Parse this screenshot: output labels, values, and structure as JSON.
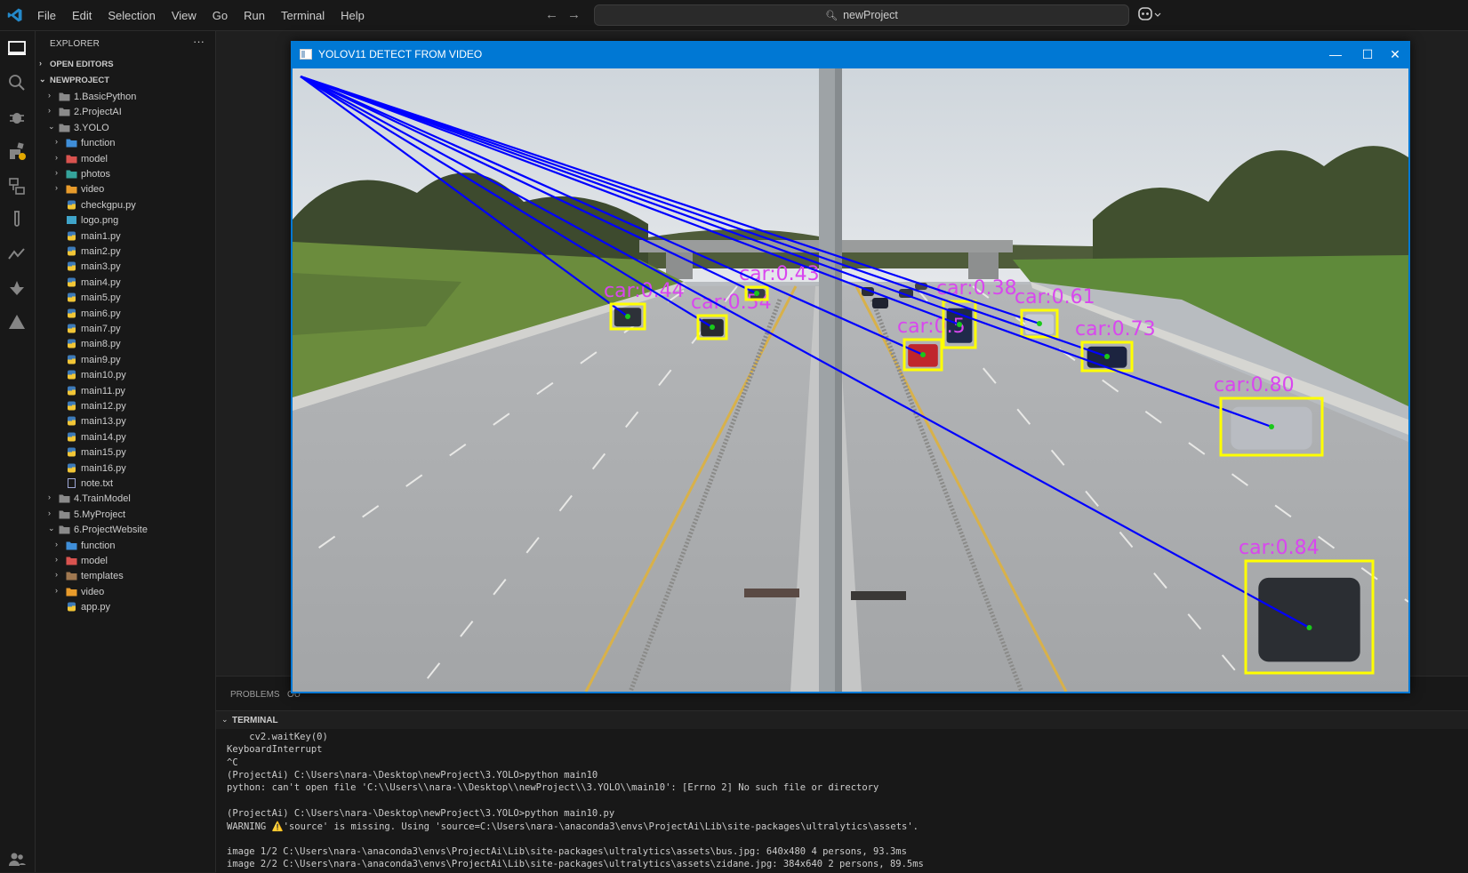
{
  "menu": {
    "items": [
      "File",
      "Edit",
      "Selection",
      "View",
      "Go",
      "Run",
      "Terminal",
      "Help"
    ],
    "search": "newProject"
  },
  "colors": {
    "accent": "#0078d4",
    "box": "#ffff00",
    "line": "#0000ff",
    "label": "#d946ef",
    "center": "#19c81a"
  },
  "explorer": {
    "title": "EXPLORER",
    "more": "···",
    "open_editors": "OPEN EDITORS",
    "project": "NEWPROJECT",
    "tree": [
      {
        "label": "1.BasicPython",
        "depth": 0,
        "kind": "folder",
        "chev": "›"
      },
      {
        "label": "2.ProjectAI",
        "depth": 0,
        "kind": "folder",
        "chev": "›"
      },
      {
        "label": "3.YOLO",
        "depth": 0,
        "kind": "folder-open",
        "chev": "⌄"
      },
      {
        "label": "function",
        "depth": 1,
        "kind": "folder-blue",
        "chev": "›"
      },
      {
        "label": "model",
        "depth": 1,
        "kind": "folder-red",
        "chev": "›"
      },
      {
        "label": "photos",
        "depth": 1,
        "kind": "folder-teal",
        "chev": "›"
      },
      {
        "label": "video",
        "depth": 1,
        "kind": "folder-orange",
        "chev": "›"
      },
      {
        "label": "checkgpu.py",
        "depth": 1,
        "kind": "py",
        "chev": ""
      },
      {
        "label": "logo.png",
        "depth": 1,
        "kind": "img",
        "chev": ""
      },
      {
        "label": "main1.py",
        "depth": 1,
        "kind": "py",
        "chev": ""
      },
      {
        "label": "main2.py",
        "depth": 1,
        "kind": "py",
        "chev": ""
      },
      {
        "label": "main3.py",
        "depth": 1,
        "kind": "py",
        "chev": ""
      },
      {
        "label": "main4.py",
        "depth": 1,
        "kind": "py",
        "chev": ""
      },
      {
        "label": "main5.py",
        "depth": 1,
        "kind": "py",
        "chev": ""
      },
      {
        "label": "main6.py",
        "depth": 1,
        "kind": "py",
        "chev": ""
      },
      {
        "label": "main7.py",
        "depth": 1,
        "kind": "py",
        "chev": ""
      },
      {
        "label": "main8.py",
        "depth": 1,
        "kind": "py",
        "chev": ""
      },
      {
        "label": "main9.py",
        "depth": 1,
        "kind": "py",
        "chev": ""
      },
      {
        "label": "main10.py",
        "depth": 1,
        "kind": "py",
        "chev": ""
      },
      {
        "label": "main11.py",
        "depth": 1,
        "kind": "py",
        "chev": ""
      },
      {
        "label": "main12.py",
        "depth": 1,
        "kind": "py",
        "chev": ""
      },
      {
        "label": "main13.py",
        "depth": 1,
        "kind": "py",
        "chev": ""
      },
      {
        "label": "main14.py",
        "depth": 1,
        "kind": "py",
        "chev": ""
      },
      {
        "label": "main15.py",
        "depth": 1,
        "kind": "py",
        "chev": ""
      },
      {
        "label": "main16.py",
        "depth": 1,
        "kind": "py",
        "chev": ""
      },
      {
        "label": "note.txt",
        "depth": 1,
        "kind": "txt",
        "chev": ""
      },
      {
        "label": "4.TrainModel",
        "depth": 0,
        "kind": "folder",
        "chev": "›"
      },
      {
        "label": "5.MyProject",
        "depth": 0,
        "kind": "folder",
        "chev": "›"
      },
      {
        "label": "6.ProjectWebsite",
        "depth": 0,
        "kind": "folder-open",
        "chev": "⌄"
      },
      {
        "label": "function",
        "depth": 1,
        "kind": "folder-blue",
        "chev": "›"
      },
      {
        "label": "model",
        "depth": 1,
        "kind": "folder-red",
        "chev": "›"
      },
      {
        "label": "templates",
        "depth": 1,
        "kind": "folder-brown",
        "chev": "›"
      },
      {
        "label": "video",
        "depth": 1,
        "kind": "folder-orange",
        "chev": "›"
      },
      {
        "label": "app.py",
        "depth": 1,
        "kind": "py",
        "chev": ""
      }
    ]
  },
  "panel": {
    "tabs": [
      "PROBLEMS",
      "OU"
    ],
    "terminal_title": "TERMINAL",
    "lines": [
      "    cv2.waitKey(0)",
      "KeyboardInterrupt",
      "^C",
      "(ProjectAi) C:\\Users\\nara-\\Desktop\\newProject\\3.YOLO>python main10",
      "python: can't open file 'C:\\\\Users\\\\nara-\\\\Desktop\\\\newProject\\\\3.YOLO\\\\main10': [Errno 2] No such file or directory",
      "",
      "(ProjectAi) C:\\Users\\nara-\\Desktop\\newProject\\3.YOLO>python main10.py",
      "WARNING ⚠️'source' is missing. Using 'source=C:\\Users\\nara-\\anaconda3\\envs\\ProjectAi\\Lib\\site-packages\\ultralytics\\assets'.",
      "",
      "image 1/2 C:\\Users\\nara-\\anaconda3\\envs\\ProjectAi\\Lib\\site-packages\\ultralytics\\assets\\bus.jpg: 640x480 4 persons, 93.3ms",
      "image 2/2 C:\\Users\\nara-\\anaconda3\\envs\\ProjectAi\\Lib\\site-packages\\ultralytics\\assets\\zidane.jpg: 384x640 2 persons, 89.5ms"
    ]
  },
  "cv_window": {
    "title": "YOLOV11 DETECT FROM VIDEO",
    "minimize": "—",
    "maximize": "☐",
    "close": "✕",
    "detections": [
      {
        "label": "car:0.44"
      },
      {
        "label": "car:0.54"
      },
      {
        "label": "car:0.43"
      },
      {
        "label": "car:0.5"
      },
      {
        "label": "car:0.38"
      },
      {
        "label": "car:0.61"
      },
      {
        "label": "car:0.73"
      },
      {
        "label": "car:0.80"
      },
      {
        "label": "car:0.84"
      }
    ]
  }
}
